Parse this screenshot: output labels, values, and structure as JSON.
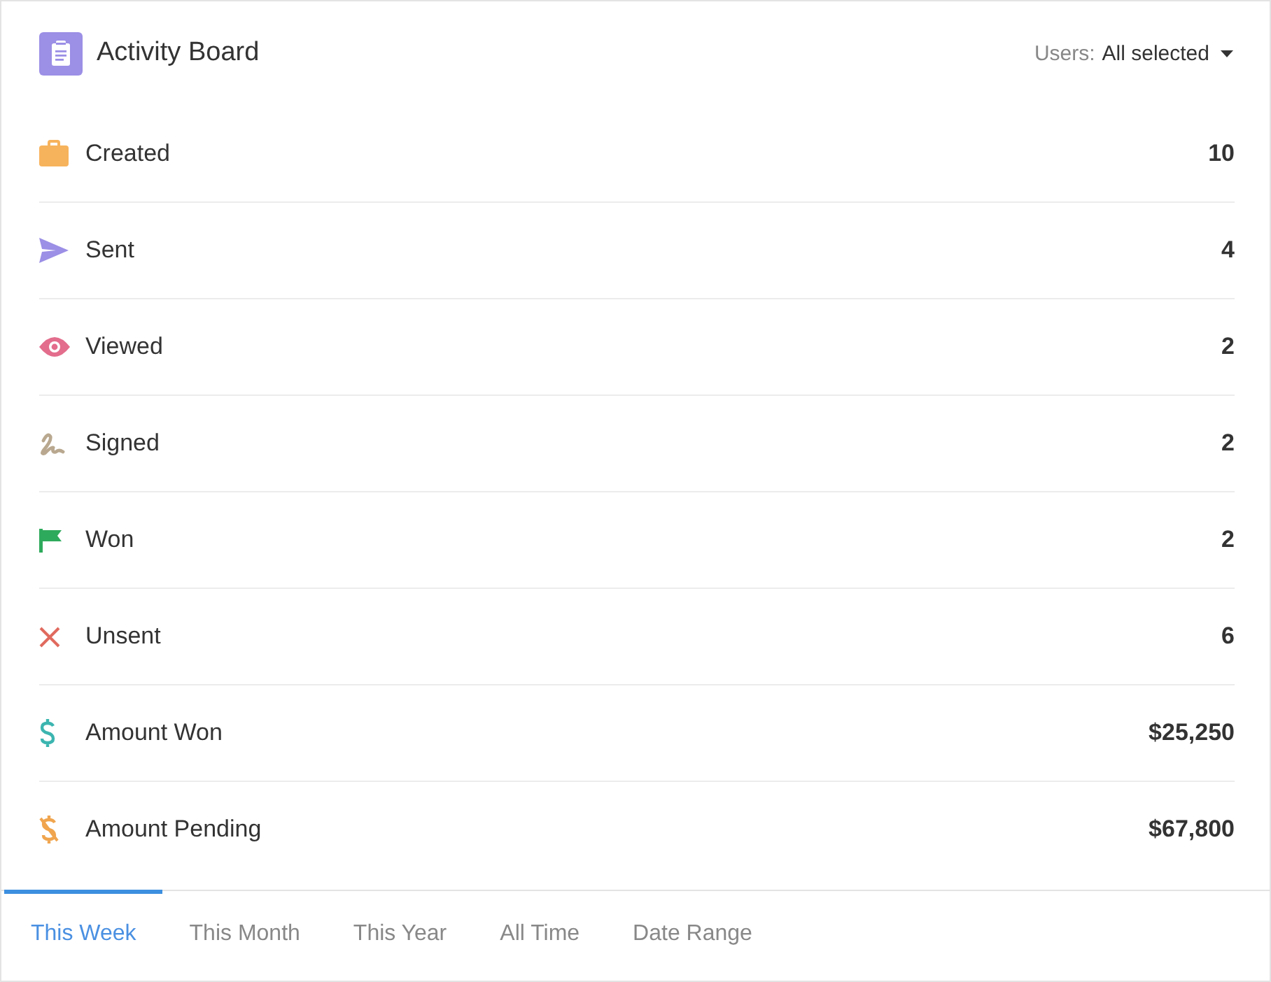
{
  "header": {
    "title": "Activity Board",
    "users_label": "Users:",
    "users_value": "All selected"
  },
  "rows": [
    {
      "kind": "created",
      "label": "Created",
      "value": "10"
    },
    {
      "kind": "sent",
      "label": "Sent",
      "value": "4"
    },
    {
      "kind": "viewed",
      "label": "Viewed",
      "value": "2"
    },
    {
      "kind": "signed",
      "label": "Signed",
      "value": "2"
    },
    {
      "kind": "won",
      "label": "Won",
      "value": "2"
    },
    {
      "kind": "unsent",
      "label": "Unsent",
      "value": "6"
    },
    {
      "kind": "amount_won",
      "label": "Amount Won",
      "value": "$25,250"
    },
    {
      "kind": "amount_pending",
      "label": "Amount Pending",
      "value": "$67,800"
    }
  ],
  "tabs": [
    {
      "label": "This Week",
      "selected": true
    },
    {
      "label": "This Month",
      "selected": false
    },
    {
      "label": "This Year",
      "selected": false
    },
    {
      "label": "All Time",
      "selected": false
    },
    {
      "label": "Date Range",
      "selected": false
    }
  ]
}
